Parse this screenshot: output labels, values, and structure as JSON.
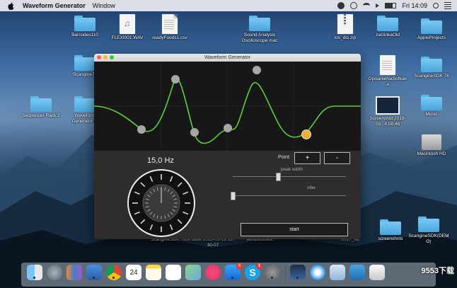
{
  "menubar": {
    "app_name": "Waveform Generator",
    "menu_window": "Window",
    "clock": "Fri 14:09"
  },
  "desktop_icons": [
    {
      "label": "Barcodes110",
      "kind": "folder"
    },
    {
      "label": "FLEXI001.WAV",
      "kind": "audio"
    },
    {
      "label": "readyFoods1.csv",
      "kind": "doc"
    },
    {
      "label": "Sound Analysis Oscilloscope mac",
      "kind": "folder"
    },
    {
      "label": "ios_dis.zip",
      "kind": "zip"
    },
    {
      "label": "zaGinkaOld",
      "kind": "folder"
    },
    {
      "label": "AppleProjects",
      "kind": "folder"
    },
    {
      "label": "Scangine78",
      "kind": "folder"
    },
    {
      "label": "OpisanieNaSoftuer a",
      "kind": "doc"
    },
    {
      "label": "ScangineSDK 76",
      "kind": "folder"
    },
    {
      "label": "Sequencer Rack 2",
      "kind": "folder"
    },
    {
      "label": "Waveform Generator M",
      "kind": "folder"
    },
    {
      "label": "Screenshot 2019-05...4.08.46",
      "kind": "screenshot"
    },
    {
      "label": "Music",
      "kind": "folder"
    },
    {
      "label": "Macintosh HD",
      "kind": "hdd"
    },
    {
      "label": "screenshots",
      "kind": "folder"
    },
    {
      "label": "ScangineSDK(DEM O)",
      "kind": "folder"
    }
  ],
  "hidden_labels": {
    "a": "ScangineSDK 78dv",
    "b": "base 2019-03-19 12-30-07",
    "c": "sendfoodsioc",
    "d": "2017_06"
  },
  "window": {
    "title": "Waveform Generator",
    "frequency_label": "15,0 Hz",
    "point_label": "Point",
    "plus_label": "+",
    "minus_label": "-",
    "peak_width_label": "peak width",
    "vibe_label": "vibe",
    "start_label": "start",
    "peak_width_value": 0.4,
    "vibe_value": 0.0,
    "wave_color": "#5ecf3a",
    "selected_point_color": "#f0b040",
    "point_color": "#a7a7a7"
  },
  "dock_items": [
    {
      "name": "Finder",
      "badge": ""
    },
    {
      "name": "Launchpad",
      "badge": ""
    },
    {
      "name": "Books",
      "badge": ""
    },
    {
      "name": "Xcode",
      "badge": ""
    },
    {
      "name": "Chrome",
      "badge": ""
    },
    {
      "name": "Calendar",
      "badge": ""
    },
    {
      "name": "Notes",
      "badge": ""
    },
    {
      "name": "Reminders",
      "badge": ""
    },
    {
      "name": "Maps",
      "badge": ""
    },
    {
      "name": "Music",
      "badge": ""
    },
    {
      "name": "App Store",
      "badge": "6"
    },
    {
      "name": "Skype",
      "badge": "1"
    },
    {
      "name": "System Preferences",
      "badge": ""
    },
    {
      "name": "Instruments",
      "badge": ""
    },
    {
      "name": "Safari",
      "badge": ""
    },
    {
      "name": "Preview",
      "badge": ""
    },
    {
      "name": "Downloads",
      "badge": ""
    }
  ],
  "watermark": "9553下载"
}
